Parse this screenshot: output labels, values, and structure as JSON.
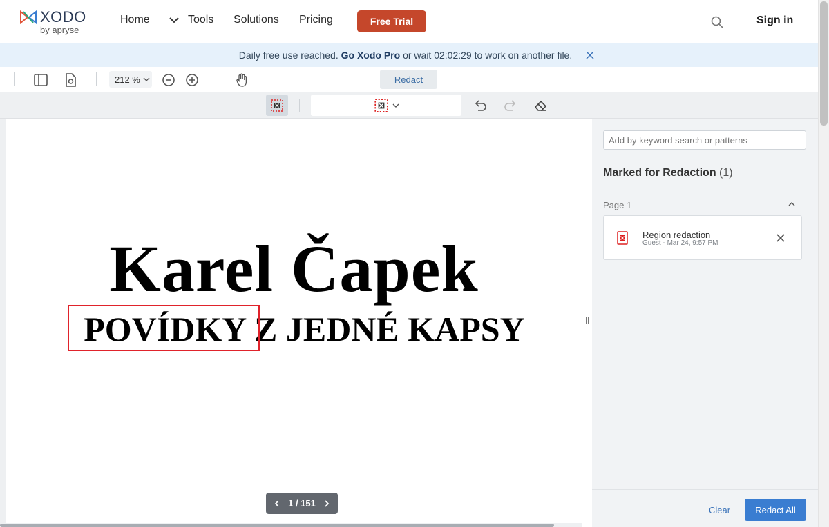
{
  "brand": {
    "name": "XODO",
    "byline": "by apryse"
  },
  "nav": {
    "home": "Home",
    "tools": "Tools",
    "solutions": "Solutions",
    "pricing": "Pricing",
    "free_trial": "Free Trial",
    "sign_in": "Sign in"
  },
  "banner": {
    "prefix": "Daily free use reached.",
    "link": "Go Xodo Pro",
    "middle": "or wait",
    "timer": "02:02:29",
    "suffix": "to work on another file."
  },
  "toolbar": {
    "zoom": "212 %",
    "redact_tab": "Redact"
  },
  "document": {
    "title": "Karel Čapek",
    "subtitle": "POVÍDKY Z JEDNÉ KAPSY",
    "page_indicator": "1 / 151"
  },
  "panel": {
    "search_placeholder": "Add by keyword search or patterns",
    "marked_title": "Marked for Redaction",
    "marked_count": "(1)",
    "page_label": "Page 1",
    "items": [
      {
        "label": "Region redaction",
        "meta": "Guest - Mar 24, 9:57 PM"
      }
    ],
    "clear": "Clear",
    "redact_all": "Redact All"
  },
  "colors": {
    "accent_orange": "#c5472b",
    "redaction_red": "#e0232b",
    "primary_blue": "#3a7dd1",
    "banner_bg": "#e6f1fb"
  }
}
